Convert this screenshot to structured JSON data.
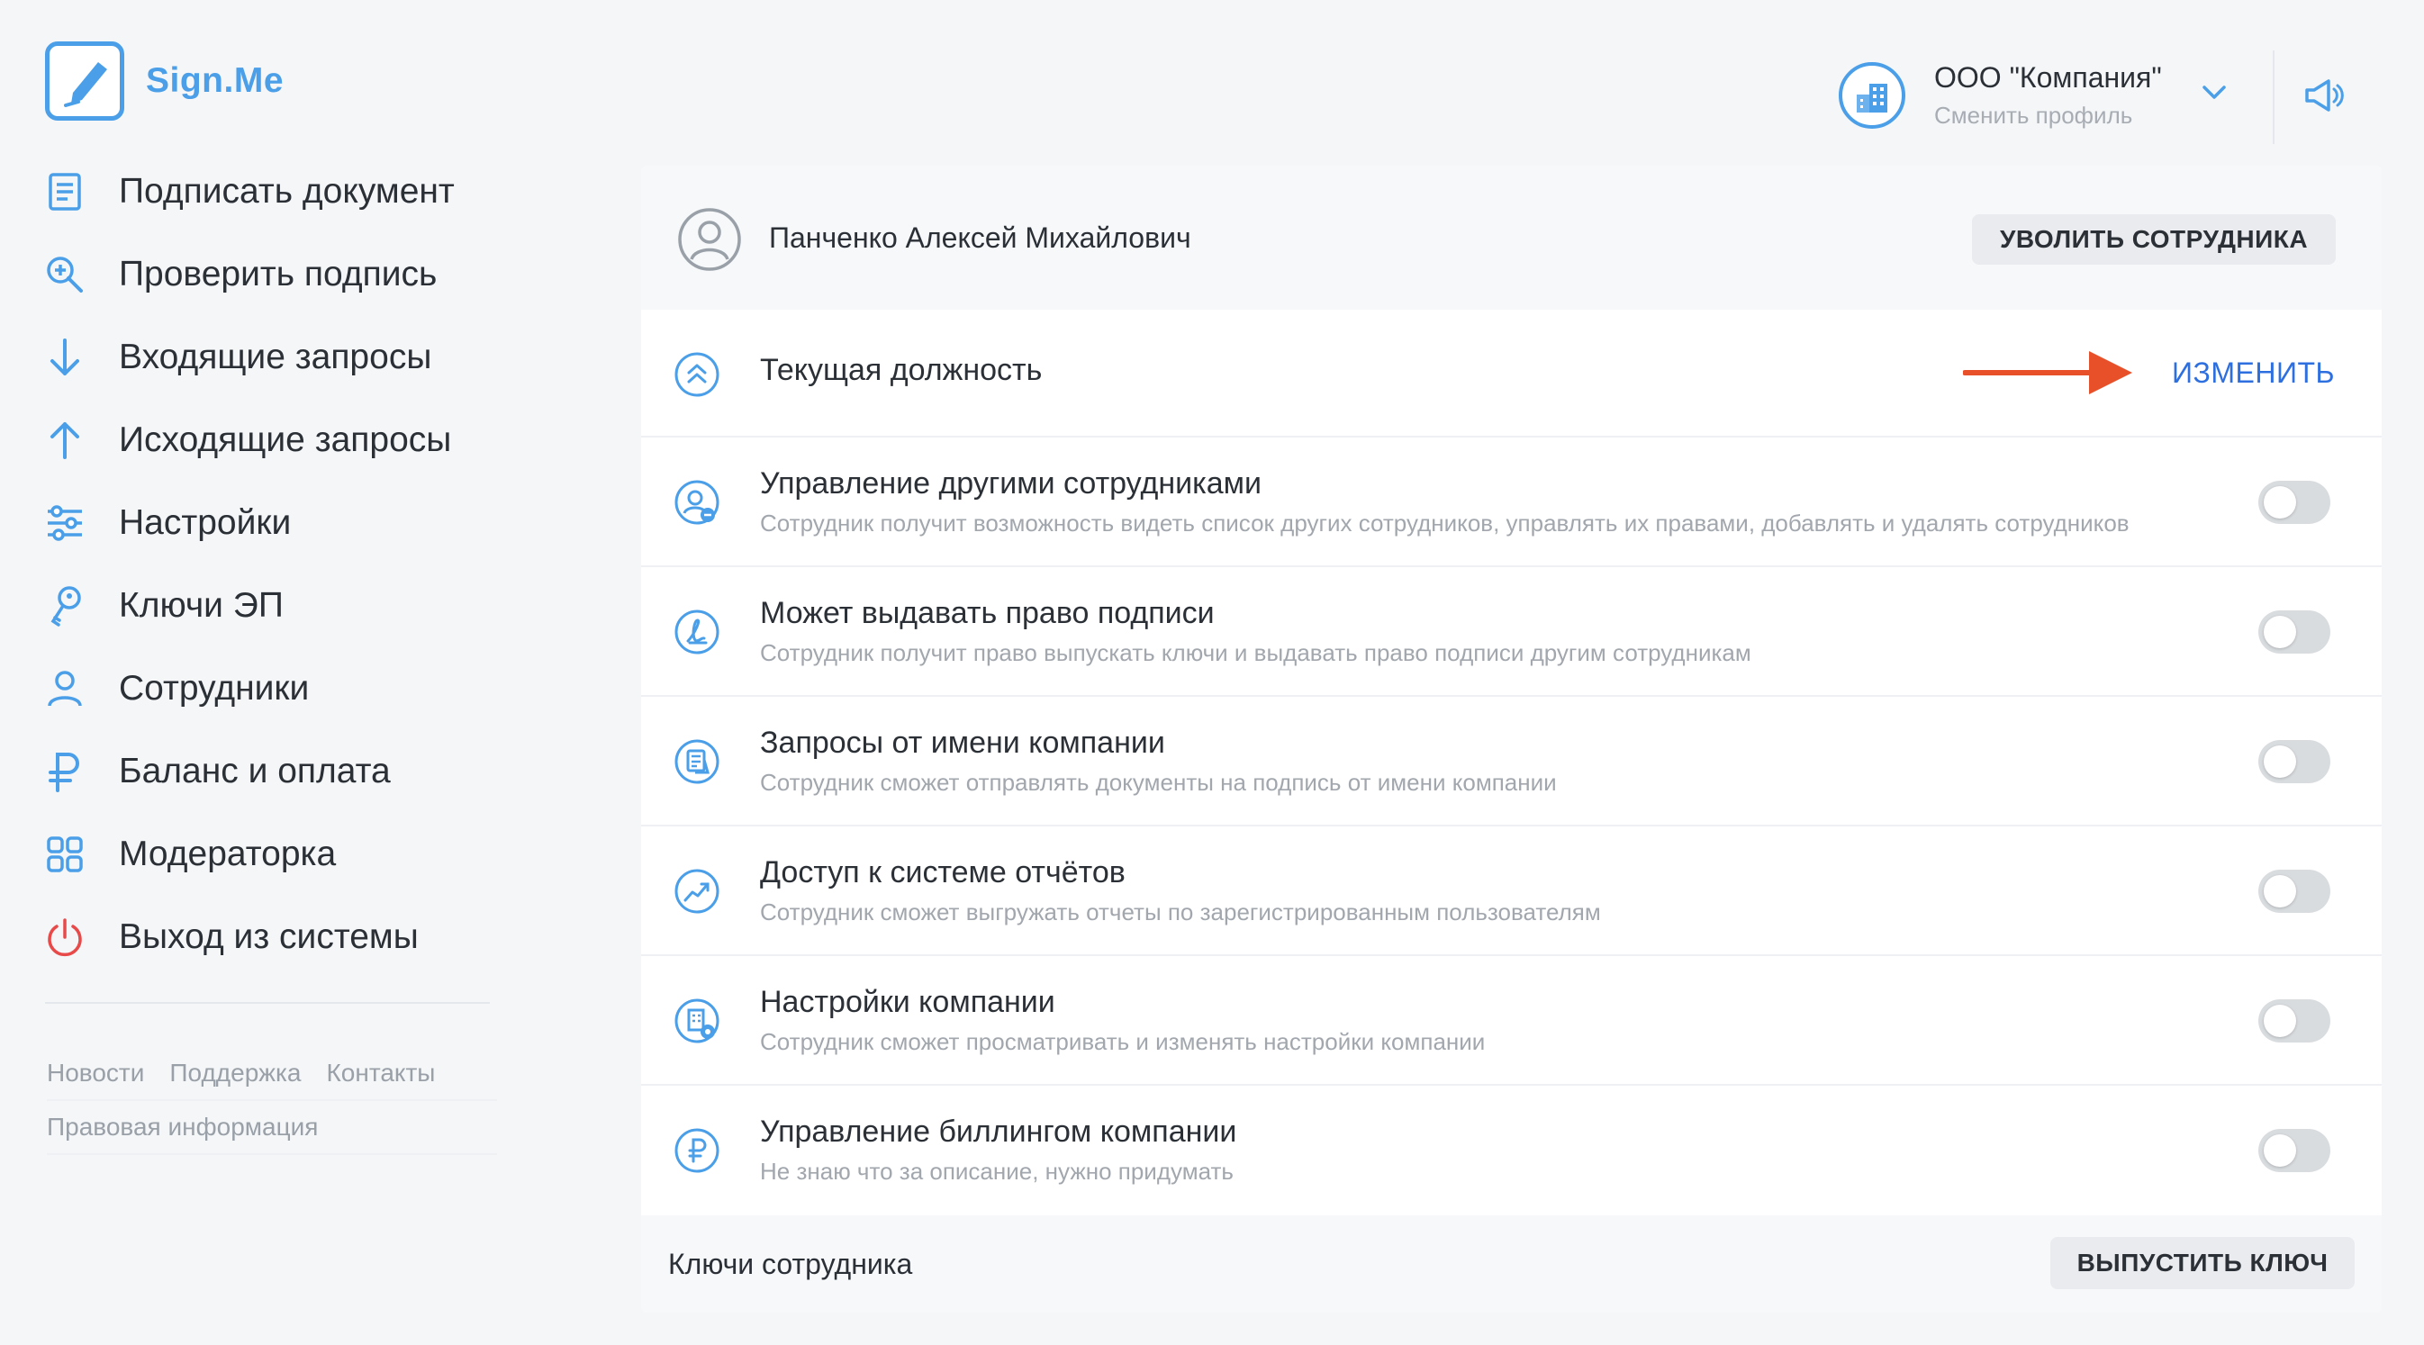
{
  "app": {
    "name": "Sign.Me"
  },
  "sidebar": {
    "items": [
      {
        "label": "Подписать документ",
        "icon": "document-icon"
      },
      {
        "label": "Проверить подпись",
        "icon": "magnifier-plus-icon"
      },
      {
        "label": "Входящие запросы",
        "icon": "arrow-down-icon"
      },
      {
        "label": "Исходящие запросы",
        "icon": "arrow-up-icon"
      },
      {
        "label": "Настройки",
        "icon": "sliders-icon"
      },
      {
        "label": "Ключи ЭП",
        "icon": "key-icon"
      },
      {
        "label": "Сотрудники",
        "icon": "person-icon"
      },
      {
        "label": "Баланс и оплата",
        "icon": "ruble-icon"
      },
      {
        "label": "Модераторка",
        "icon": "grid-icon"
      },
      {
        "label": "Выход из системы",
        "icon": "power-icon"
      }
    ],
    "footer": {
      "news": "Новости",
      "support": "Поддержка",
      "contacts": "Контакты",
      "legal": "Правовая информация"
    }
  },
  "header": {
    "company_name": "ООО \"Компания\"",
    "switch_profile": "Сменить профиль"
  },
  "employee": {
    "name": "Панченко Алексей Михайлович",
    "fire_button": "УВОЛИТЬ СОТРУДНИКА",
    "position": {
      "title": "Текущая должность",
      "change_link": "ИЗМЕНИТЬ"
    },
    "permissions": [
      {
        "title": "Управление другими сотрудниками",
        "desc": "Сотрудник получит возможность видеть список других сотрудников, управлять их правами, добавлять и удалять сотрудников",
        "enabled": false
      },
      {
        "title": "Может выдавать право подписи",
        "desc": "Сотрудник получит право выпускать ключи и выдавать право подписи другим сотрудникам",
        "enabled": false
      },
      {
        "title": "Запросы от имени компании",
        "desc": "Сотрудник сможет отправлять документы на подпись от имени компании",
        "enabled": false
      },
      {
        "title": "Доступ к системе отчётов",
        "desc": "Сотрудник сможет выгружать отчеты по зарегистрированным пользователям",
        "enabled": false
      },
      {
        "title": "Настройки компании",
        "desc": "Сотрудник сможет просматривать и изменять настройки компании",
        "enabled": false
      },
      {
        "title": "Управление биллингом компании",
        "desc": "Не знаю что за описание, нужно придумать",
        "enabled": false
      }
    ],
    "keys_label": "Ключи сотрудника",
    "issue_key_button": "ВЫПУСТИТЬ КЛЮЧ"
  },
  "colors": {
    "accent": "#4a9fe8",
    "link": "#2e6fe0",
    "exit": "#e84a4a",
    "arrow": "#e8502a"
  }
}
